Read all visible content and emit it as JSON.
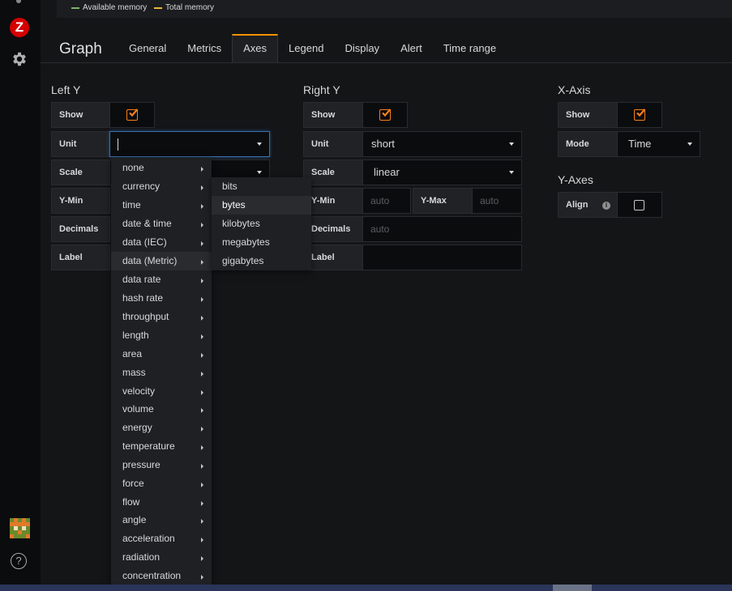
{
  "legend": [
    {
      "label": "Available memory",
      "color": "#7eb26d"
    },
    {
      "label": "Total memory",
      "color": "#eab839"
    }
  ],
  "editor": {
    "title": "Graph",
    "tabs": [
      "General",
      "Metrics",
      "Axes",
      "Legend",
      "Display",
      "Alert",
      "Time range"
    ],
    "active_tab": "Axes"
  },
  "left_y": {
    "title": "Left Y",
    "show_label": "Show",
    "show_checked": true,
    "unit_label": "Unit",
    "unit_value": "",
    "scale_label": "Scale",
    "ymin_label": "Y-Min",
    "decimals_label": "Decimals",
    "label_label": "Label"
  },
  "right_y": {
    "title": "Right Y",
    "show_label": "Show",
    "show_checked": true,
    "unit_label": "Unit",
    "unit_value": "short",
    "scale_label": "Scale",
    "scale_value": "linear",
    "ymin_label": "Y-Min",
    "ymin_placeholder": "auto",
    "ymax_label": "Y-Max",
    "ymax_placeholder": "auto",
    "decimals_label": "Decimals",
    "decimals_placeholder": "auto",
    "label_label": "Label"
  },
  "x_axis": {
    "title": "X-Axis",
    "show_label": "Show",
    "show_checked": true,
    "mode_label": "Mode",
    "mode_value": "Time"
  },
  "y_axes": {
    "title": "Y-Axes",
    "align_label": "Align",
    "align_checked": false
  },
  "unit_menu": {
    "items": [
      "none",
      "currency",
      "time",
      "date & time",
      "data (IEC)",
      "data (Metric)",
      "data rate",
      "hash rate",
      "throughput",
      "length",
      "area",
      "mass",
      "velocity",
      "volume",
      "energy",
      "temperature",
      "pressure",
      "force",
      "flow",
      "angle",
      "acceleration",
      "radiation",
      "concentration"
    ],
    "hovered": "data (Metric)",
    "submenu": [
      "bits",
      "bytes",
      "kilobytes",
      "megabytes",
      "gigabytes"
    ],
    "submenu_hovered": "bytes"
  },
  "colors": {
    "accent": "#f7801c",
    "tab_active_border": "#f59200",
    "logo_red": "#d40000"
  },
  "icons": {
    "logo": "Z",
    "help": "?",
    "info": "i"
  }
}
